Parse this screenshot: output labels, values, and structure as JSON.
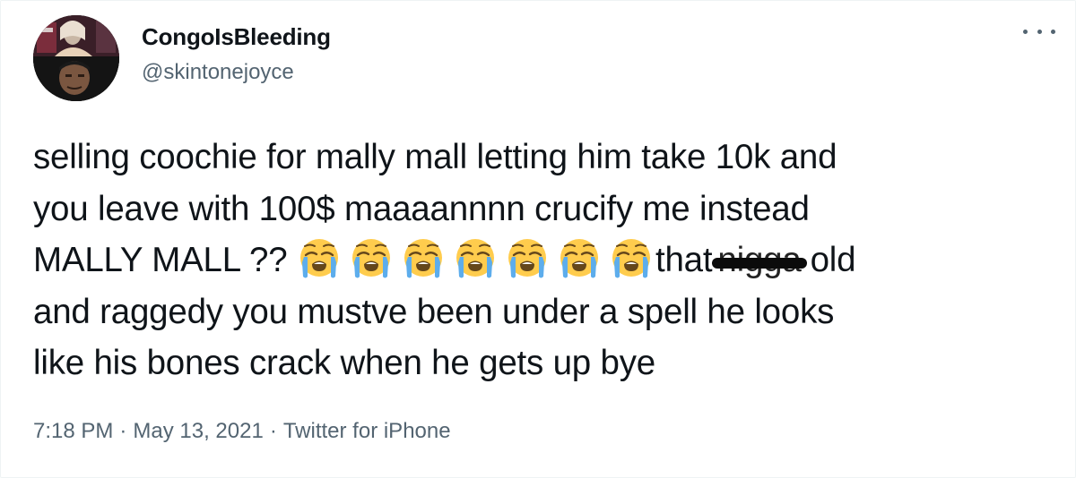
{
  "tweet": {
    "display_name": "CongoIsBleeding",
    "handle": "@skintonejoyce",
    "more_icon": "more-horizontal-icon",
    "text_line1": "selling coochie for mally mall letting him take 10k and",
    "text_line2": "you leave with 100$ maaaannnn crucify me instead",
    "text_line3_start": "MALLY MALL ??",
    "emoji_name": "loudly-crying-face-icon",
    "emoji_count": 7,
    "text_line3_that": "that",
    "censored_word": "nigga",
    "text_line3_end": "old",
    "text_line4": "and raggedy you mustve been under a spell he looks",
    "text_line5": "like his bones crack when he gets up bye",
    "time": "7:18 PM",
    "date": "May 13, 2021",
    "source": "Twitter for iPhone",
    "separator": "·"
  }
}
